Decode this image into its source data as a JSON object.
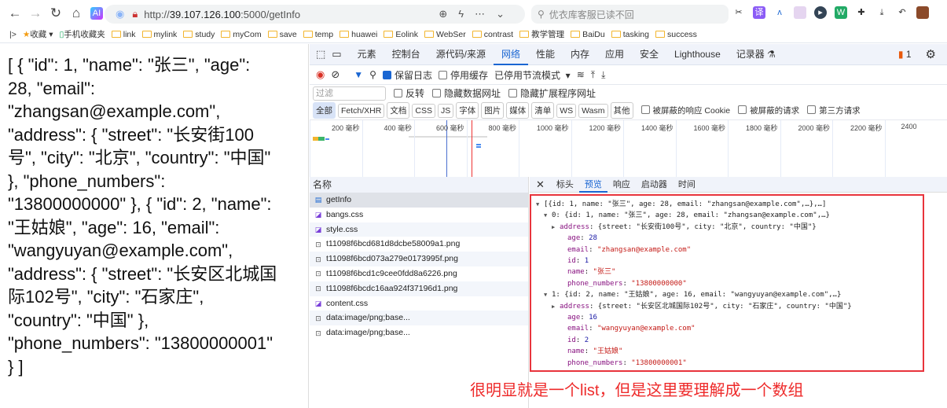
{
  "browser": {
    "url_prefix": "http://",
    "url_host": "39.107.126.100",
    "url_rest": ":5000/getInfo",
    "search_placeholder": "优衣库客服已读不回"
  },
  "bookmarks": [
    "收藏",
    "手机收藏夹",
    "link",
    "mylink",
    "study",
    "myCom",
    "save",
    "temp",
    "huawei",
    "Eolink",
    "WebSer",
    "contrast",
    "教学管理",
    "BaiDu",
    "tasking",
    "success"
  ],
  "page_lines": [
    "[ { \"id\": 1, \"name\": \"张三\", \"age\":",
    "28, \"email\":",
    "\"zhangsan@example.com\",",
    "\"address\": { \"street\": \"长安街100",
    "号\", \"city\": \"北京\", \"country\": \"中国\"",
    "}, \"phone_numbers\":",
    "\"13800000000\" }, { \"id\": 2, \"name\":",
    "\"王姑娘\", \"age\": 16, \"email\":",
    "\"wangyuyan@example.com\",",
    "\"address\": { \"street\": \"长安区北城国",
    "际102号\", \"city\": \"石家庄\",",
    "\"country\": \"中国\" },",
    "\"phone_numbers\": \"13800000001\"",
    "} ]"
  ],
  "devtools": {
    "tabs": [
      "元素",
      "控制台",
      "源代码/来源",
      "网络",
      "性能",
      "内存",
      "应用",
      "安全",
      "Lighthouse",
      "记录器 ⚗"
    ],
    "active_tab": "网络",
    "issues_count": "1",
    "toolbar": {
      "preserve_log": "保留日志",
      "disable_cache": "停用缓存",
      "throttle": "已停用节流模式"
    },
    "filter": {
      "placeholder": "过滤",
      "invert": "反转",
      "hide_data_urls": "隐藏数据网址",
      "hide_ext_urls": "隐藏扩展程序网址"
    },
    "types": [
      "全部",
      "Fetch/XHR",
      "文档",
      "CSS",
      "JS",
      "字体",
      "图片",
      "媒体",
      "清单",
      "WS",
      "Wasm",
      "其他"
    ],
    "type_checks": [
      "被屏蔽的响应 Cookie",
      "被屏蔽的请求",
      "第三方请求"
    ],
    "timeline_ticks": [
      "200 毫秒",
      "400 毫秒",
      "600 毫秒",
      "800 毫秒",
      "1000 毫秒",
      "1200 毫秒",
      "1400 毫秒",
      "1600 毫秒",
      "1800 毫秒",
      "2000 毫秒",
      "2200 毫秒",
      "2400"
    ],
    "list_header": "名称",
    "requests": [
      {
        "name": "getInfo",
        "icon": "document-icon"
      },
      {
        "name": "bangs.css",
        "icon": "stylesheet-icon"
      },
      {
        "name": "style.css",
        "icon": "stylesheet-icon"
      },
      {
        "name": "t11098f6bcd681d8dcbe58009a1.png",
        "icon": "image-icon"
      },
      {
        "name": "t11098f6bcd073a279e0173995f.png",
        "icon": "image-icon"
      },
      {
        "name": "t11098f6bcd1c9cee0fdd8a6226.png",
        "icon": "image-icon"
      },
      {
        "name": "t11098f6bcdc16aa924f37196d1.png",
        "icon": "image-icon"
      },
      {
        "name": "content.css",
        "icon": "stylesheet-icon"
      },
      {
        "name": "data:image/png;base...",
        "icon": "image-icon"
      },
      {
        "name": "data:image/png;base...",
        "icon": "image-icon"
      }
    ],
    "detail_tabs": [
      "标头",
      "预览",
      "响应",
      "启动器",
      "时间"
    ],
    "active_detail_tab": "预览",
    "preview": {
      "root": "[{id: 1, name: \"张三\", age: 28, email: \"zhangsan@example.com\",…},…]",
      "items": [
        {
          "summary": "0: {id: 1, name: \"张三\", age: 28, email: \"zhangsan@example.com\",…}",
          "address": "{street: \"长安街100号\", city: \"北京\", country: \"中国\"}",
          "age": "28",
          "email": "\"zhangsan@example.com\"",
          "id": "1",
          "name": "\"张三\"",
          "phone_numbers": "\"13800000000\""
        },
        {
          "summary": "1: {id: 2, name: \"王姑娘\", age: 16, email: \"wangyuyan@example.com\",…}",
          "address": "{street: \"长安区北城国际102号\", city: \"石家庄\", country: \"中国\"}",
          "age": "16",
          "email": "\"wangyuyan@example.com\"",
          "id": "2",
          "name": "\"王姑娘\"",
          "phone_numbers": "\"13800000001\""
        }
      ]
    }
  },
  "annotation": "很明显就是一个list，但是这里要理解成一个数组",
  "colors": {
    "accent": "#1a66d2",
    "annotation": "#ee2b2b"
  }
}
